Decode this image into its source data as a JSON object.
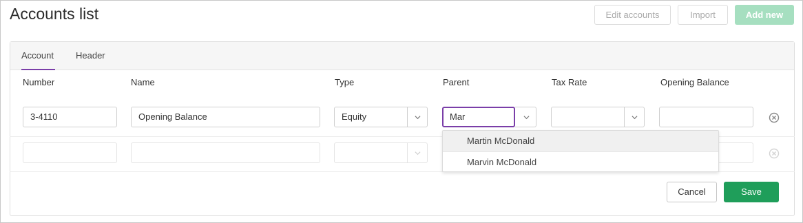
{
  "header": {
    "title": "Accounts list",
    "edit_accounts_label": "Edit accounts",
    "import_label": "Import",
    "add_new_label": "Add new"
  },
  "tabs": [
    {
      "label": "Account",
      "active": true
    },
    {
      "label": "Header",
      "active": false
    }
  ],
  "columns": [
    "Number",
    "Name",
    "Type",
    "Parent",
    "Tax Rate",
    "Opening Balance"
  ],
  "rows": [
    {
      "number": "3-4110",
      "name": "Opening Balance",
      "type": "Equity",
      "parent": "Mar",
      "tax_rate": "",
      "opening_balance": ""
    },
    {
      "number": "",
      "name": "",
      "type": "",
      "parent": "",
      "tax_rate": "",
      "opening_balance": ""
    }
  ],
  "parent_dropdown": {
    "options": [
      "Martin McDonald",
      "Marvin McDonald"
    ],
    "highlighted_index": 0
  },
  "footer": {
    "cancel_label": "Cancel",
    "save_label": "Save"
  },
  "colors": {
    "accent": "#7a3ea8",
    "primary_button": "#1f9e5a",
    "disabled_primary": "#a6dfc0"
  },
  "icons": {
    "select_toggle": "chevron-down-icon",
    "remove_row": "remove-row-icon"
  }
}
